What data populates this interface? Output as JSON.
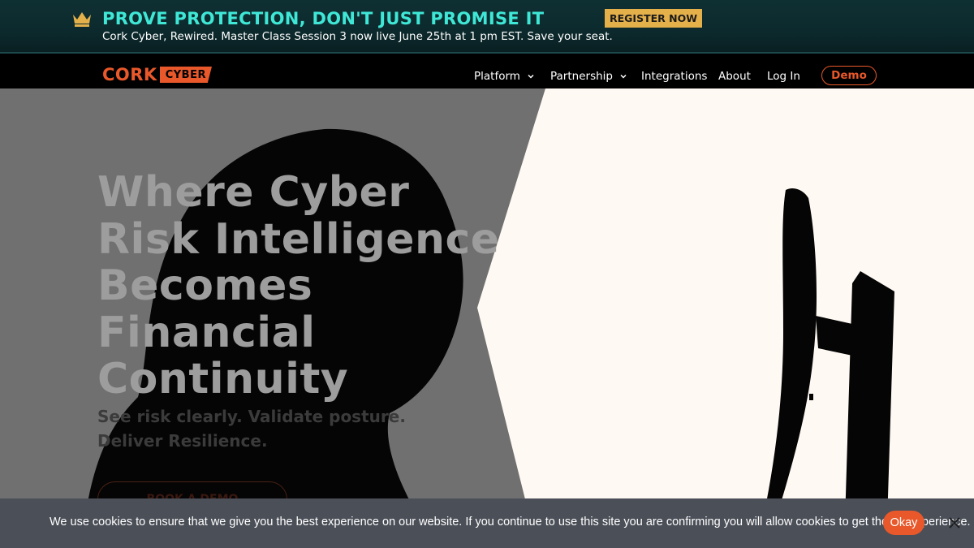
{
  "banner": {
    "title": "PROVE PROTECTION, DON'T JUST PROMISE IT",
    "subtitle": "Cork Cyber, Rewired. Master Class Session 3 now live June 25th at 1 pm EST. Save your seat.",
    "cta_label": "REGISTER NOW",
    "icon": "crown-icon"
  },
  "nav": {
    "logo_word": "CORK",
    "logo_tag": "CYBER",
    "items": [
      {
        "label": "Platform",
        "has_dropdown": true
      },
      {
        "label": "Partnership",
        "has_dropdown": true
      },
      {
        "label": "Integrations",
        "has_dropdown": false
      },
      {
        "label": "About",
        "has_dropdown": false
      },
      {
        "label": "Log In",
        "has_dropdown": false
      }
    ],
    "demo_label": "Demo"
  },
  "hero": {
    "headline": "Where Cyber Risk Intelligence Becomes Financial Continuity",
    "subheadline": "See risk clearly. Validate posture. Deliver Resilience.",
    "cta_label": "BOOK A DEMO"
  },
  "cookie": {
    "message": "We use cookies to ensure that we give you the best experience on our website. If you continue to use this site you are confirming you will allow cookies to get the full experience.",
    "accept_label": "Okay",
    "close_icon": "close-icon"
  },
  "colors": {
    "accent": "#e8582a",
    "banner_title": "#3fe7d6",
    "register_button": "#e4b04a",
    "cookie_bar": "#4b4f58",
    "hero_light": "#fef9f3"
  }
}
